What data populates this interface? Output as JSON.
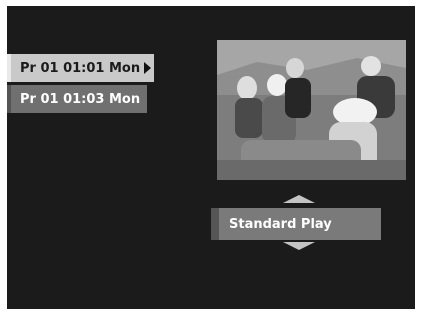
{
  "recordings": [
    {
      "label": "Pr 01 01:01 Mon",
      "selected": true
    },
    {
      "label": "Pr 01 01:03 Mon",
      "selected": false
    }
  ],
  "preview": {
    "description_icon": "video-preview"
  },
  "play_mode": {
    "label": "Standard Play"
  },
  "colors": {
    "screen_bg": "#1b1b1b",
    "selected_item": "#c9c9c9",
    "item": "#707070",
    "mode_box": "#7a7a7a"
  }
}
